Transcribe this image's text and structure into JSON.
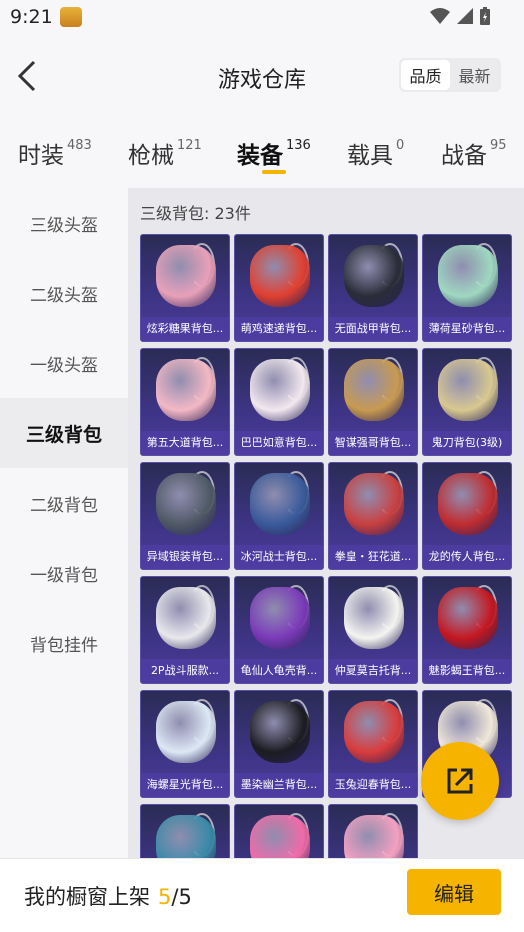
{
  "status_bar": {
    "time": "9:21"
  },
  "header": {
    "title": "游戏仓库",
    "sort_options": [
      "品质",
      "最新"
    ],
    "active_sort": "品质"
  },
  "tabs": [
    {
      "label": "时装",
      "count": "483"
    },
    {
      "label": "枪械",
      "count": "121"
    },
    {
      "label": "装备",
      "count": "136"
    },
    {
      "label": "载具",
      "count": "0"
    },
    {
      "label": "战备",
      "count": "95"
    }
  ],
  "active_tab": "装备",
  "sidebar": {
    "items": [
      "三级头盔",
      "二级头盔",
      "一级头盔",
      "三级背包",
      "二级背包",
      "一级背包",
      "背包挂件"
    ],
    "active": "三级背包"
  },
  "section": {
    "title": "三级背包: 23件"
  },
  "items": [
    {
      "name": "炫彩糖果背包...",
      "color": "#e8a0b8"
    },
    {
      "name": "萌鸡速递背包...",
      "color": "#e04030"
    },
    {
      "name": "无面战甲背包...",
      "color": "#2a2d38"
    },
    {
      "name": "薄荷星砂背包...",
      "color": "#9fd8c0"
    },
    {
      "name": "第五大道背包...",
      "color": "#f4b8c4"
    },
    {
      "name": "巴巴如意背包...",
      "color": "#f2e8ee"
    },
    {
      "name": "智谋强哥背包...",
      "color": "#c89a50"
    },
    {
      "name": "鬼刀背包(3级)",
      "color": "#d8c890"
    },
    {
      "name": "异域银装背包...",
      "color": "#505a66"
    },
    {
      "name": "冰河战士背包...",
      "color": "#3a5a9a"
    },
    {
      "name": "拳皇・狂花道...",
      "color": "#c84040"
    },
    {
      "name": "龙的传人背包...",
      "color": "#c02c30"
    },
    {
      "name": "2P战斗服款...",
      "color": "#e8e8ec"
    },
    {
      "name": "龟仙人龟壳背...",
      "color": "#7a3ab8"
    },
    {
      "name": "仲夏莫吉托背...",
      "color": "#f4f4f0"
    },
    {
      "name": "魅影蝎王背包...",
      "color": "#c41820"
    },
    {
      "name": "海螺星光背包...",
      "color": "#dce8f4"
    },
    {
      "name": "墨染幽兰背包...",
      "color": "#1c1c22"
    },
    {
      "name": "玉兔迎春背包...",
      "color": "#d83c3c"
    },
    {
      "name": "",
      "color": "#f0e8d8"
    },
    {
      "name": "",
      "color": "#3a8aa8"
    },
    {
      "name": "",
      "color": "#f06aa8"
    },
    {
      "name": "",
      "color": "#f4a0c0"
    }
  ],
  "bottom": {
    "label": "我的橱窗上架",
    "current": "5",
    "total": "/5",
    "edit_label": "编辑"
  }
}
